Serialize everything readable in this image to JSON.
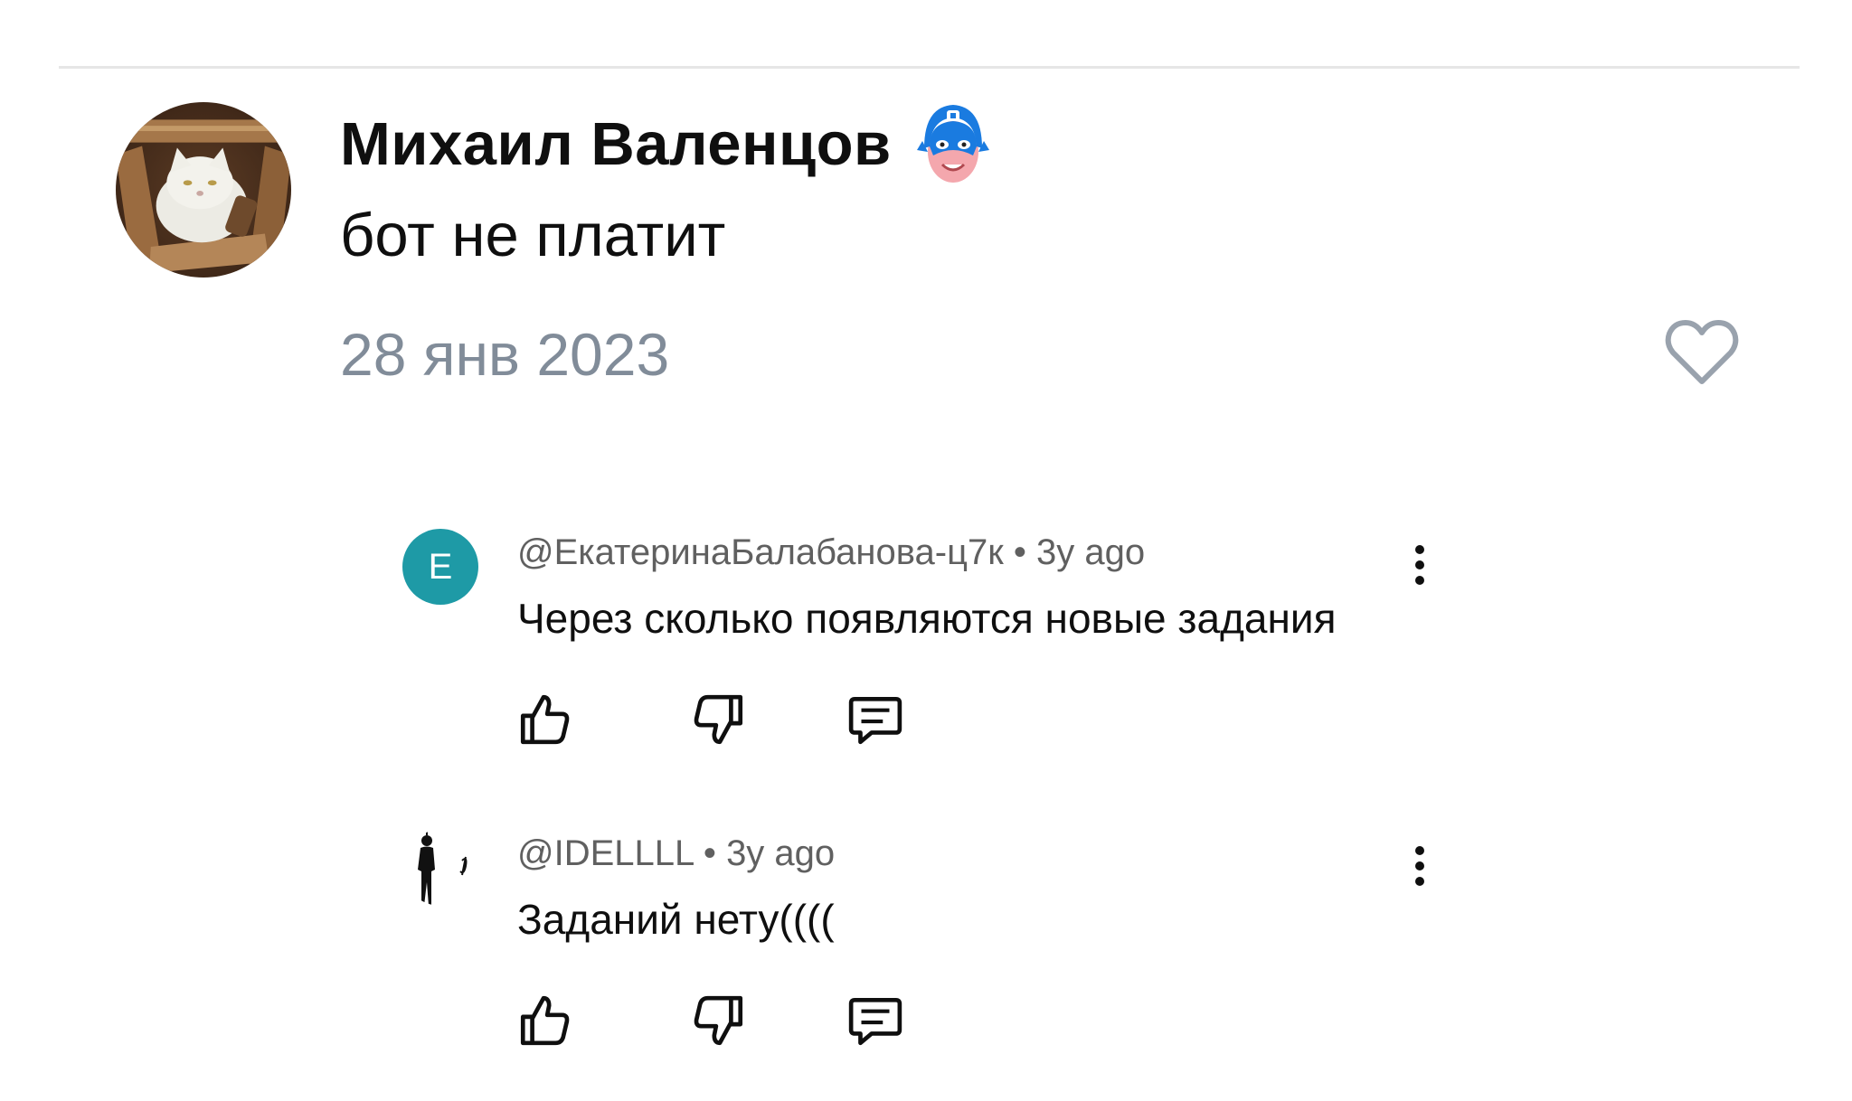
{
  "post": {
    "author": "Михаил Валенцов",
    "text": "бот не платит",
    "date": "28 янв 2023",
    "avatar_icon": "white-cat-photo-avatar",
    "badge_icon": "blue-mask-hero-emoji",
    "like_icon": "heart-outline-icon",
    "date_color": "#818c99"
  },
  "replies": [
    {
      "avatar_letter": "E",
      "avatar_color": "#1e9aa6",
      "handle": "@ЕкатеринаБалабанова-ц7к",
      "separator": "•",
      "age": "3y ago",
      "text": "Через сколько появляются новые задания"
    },
    {
      "avatar_icon": "silhouette-avatar",
      "handle": "@IDELLLL",
      "separator": "•",
      "age": "3y ago",
      "text": "Заданий нету(((("
    }
  ],
  "icons": {
    "like": "thumbs-up-icon",
    "dislike": "thumbs-down-icon",
    "reply": "comment-icon",
    "more": "more-vert-icon"
  }
}
